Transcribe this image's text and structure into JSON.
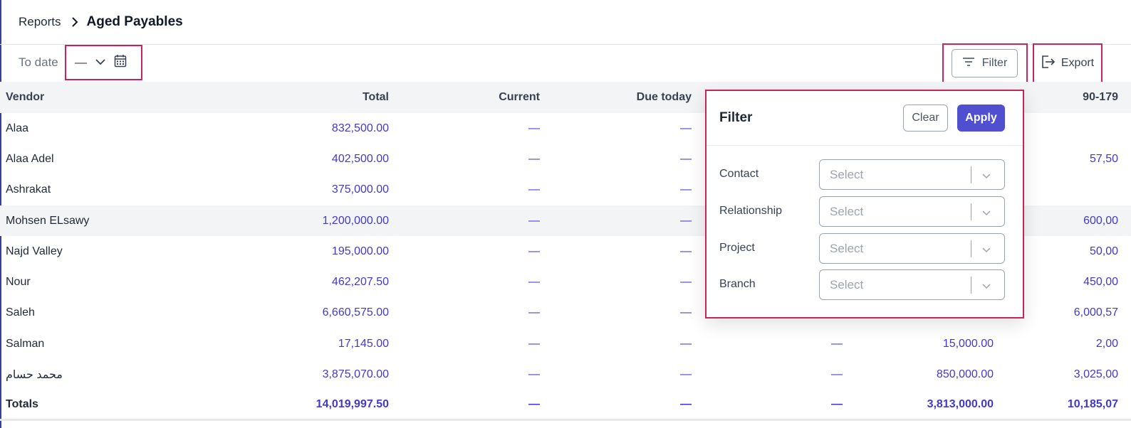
{
  "breadcrumb": {
    "parent": "Reports",
    "current": "Aged Payables"
  },
  "toolbar": {
    "to_date_label": "To date",
    "date_value": "—",
    "filter_label": "Filter",
    "export_label": "Export"
  },
  "table": {
    "headers": [
      "Vendor",
      "Total",
      "Current",
      "Due today",
      "",
      "",
      "90-179"
    ],
    "rows": [
      {
        "vendor": "Alaa",
        "total": "832,500.00",
        "current": "—",
        "due_today": "—",
        "c4": "",
        "c5": "",
        "c6": ""
      },
      {
        "vendor": "Alaa Adel",
        "total": "402,500.00",
        "current": "—",
        "due_today": "—",
        "c4": "",
        "c5": "",
        "c6": "57,50"
      },
      {
        "vendor": "Ashrakat",
        "total": "375,000.00",
        "current": "—",
        "due_today": "—",
        "c4": "",
        "c5": "",
        "c6": ""
      },
      {
        "vendor": "Mohsen ELsawy",
        "total": "1,200,000.00",
        "current": "—",
        "due_today": "—",
        "c4": "",
        "c5": "",
        "c6": "600,00"
      },
      {
        "vendor": "Najd Valley",
        "total": "195,000.00",
        "current": "—",
        "due_today": "—",
        "c4": "",
        "c5": "",
        "c6": "50,00"
      },
      {
        "vendor": "Nour",
        "total": "462,207.50",
        "current": "—",
        "due_today": "—",
        "c4": "",
        "c5": "",
        "c6": "450,00"
      },
      {
        "vendor": "Saleh",
        "total": "6,660,575.00",
        "current": "—",
        "due_today": "—",
        "c4": "",
        "c5": "",
        "c6": "6,000,57"
      },
      {
        "vendor": "Salman",
        "total": "17,145.00",
        "current": "—",
        "due_today": "—",
        "c4": "—",
        "c5": "15,000.00",
        "c6": "2,00"
      },
      {
        "vendor": "محمد حسام",
        "total": "3,875,070.00",
        "current": "—",
        "due_today": "—",
        "c4": "—",
        "c5": "850,000.00",
        "c6": "3,025,00"
      }
    ],
    "totals": {
      "vendor": "Totals",
      "total": "14,019,997.50",
      "current": "—",
      "due_today": "—",
      "c4": "—",
      "c5": "3,813,000.00",
      "c6": "10,185,07"
    }
  },
  "filter_panel": {
    "title": "Filter",
    "clear_label": "Clear",
    "apply_label": "Apply",
    "fields": [
      {
        "label": "Contact",
        "placeholder": "Select"
      },
      {
        "label": "Relationship",
        "placeholder": "Select"
      },
      {
        "label": "Project",
        "placeholder": "Select"
      },
      {
        "label": "Branch",
        "placeholder": "Select"
      }
    ]
  },
  "colors": {
    "accent": "#4f4fcf",
    "amount": "#4338ca",
    "highlight": "#c7255a"
  },
  "icons": {
    "breadcrumb": "chevron-right-icon",
    "date": "calendar-icon",
    "filter": "filter-lines-icon",
    "export": "export-icon",
    "select": "chevron-down-icon"
  }
}
